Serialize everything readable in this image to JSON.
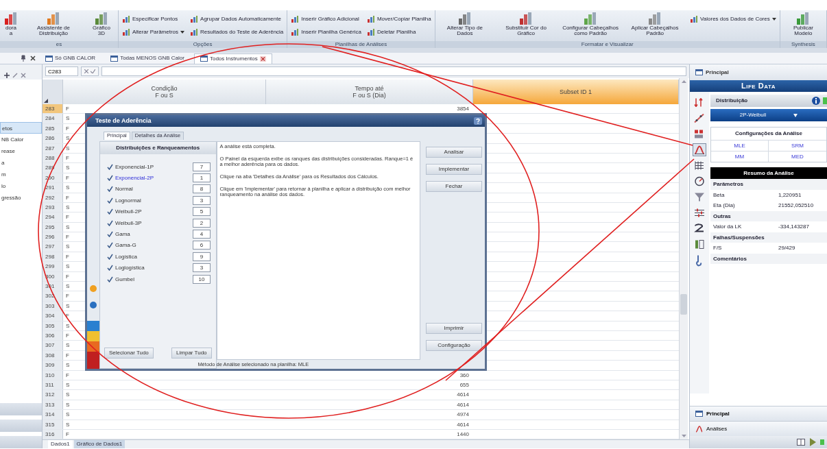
{
  "ribbon": {
    "groups": [
      {
        "label": "es",
        "items": [
          {
            "kind": "large",
            "label": "dora\na"
          },
          {
            "kind": "large",
            "label": "Assistente de Distribuição"
          },
          {
            "kind": "large",
            "label": "Gráfico 3D"
          }
        ]
      },
      {
        "label": "Opções",
        "items": [
          {
            "kind": "small",
            "label": "Especificar Pontos",
            "dropdown": false
          },
          {
            "kind": "small",
            "label": "Alterar Parâmetros",
            "dropdown": true
          },
          {
            "kind": "small",
            "label": "Agrupar Dados Automaticamente",
            "dropdown": false
          },
          {
            "kind": "small",
            "label": "Resultados do Teste de Aderência",
            "dropdown": false
          }
        ]
      },
      {
        "label": "Planilhas de Análises",
        "items": [
          {
            "kind": "small",
            "label": "Inserir Gráfico Adicional",
            "dropdown": false
          },
          {
            "kind": "small",
            "label": "Inserir Planilha Genérica",
            "dropdown": false
          },
          {
            "kind": "small",
            "label": "Mover/Copiar Planilha",
            "dropdown": false
          },
          {
            "kind": "small",
            "label": "Deletar Planilha",
            "dropdown": false
          }
        ]
      },
      {
        "label": "Formatar e Visualizar",
        "items": [
          {
            "kind": "large",
            "label": "Alterar Tipo de Dados"
          },
          {
            "kind": "large",
            "label": "Substituir Cor do Gráfico"
          },
          {
            "kind": "large",
            "label": "Configurar Cabeçalhos como Padrão"
          },
          {
            "kind": "large",
            "label": "Aplicar Cabeçalhos Padrão"
          },
          {
            "kind": "small",
            "label": "Valores dos Dados de Cores",
            "dropdown": true
          }
        ]
      },
      {
        "label": "Synthesis",
        "items": [
          {
            "kind": "large",
            "label": "Publicar Modelo"
          }
        ]
      }
    ]
  },
  "doc_tabs": [
    {
      "label": "Só GNB CALOR",
      "selected": false
    },
    {
      "label": "Todas MENOS GNB Calor",
      "selected": false
    },
    {
      "label": "Todos Instrumentos",
      "selected": true
    }
  ],
  "left_panel": {
    "items": [
      {
        "label": "etos",
        "selected": true
      },
      {
        "label": "NB Calor",
        "selected": false
      },
      {
        "label": "rease",
        "selected": false
      },
      {
        "label": "a",
        "selected": false
      },
      {
        "label": "m",
        "selected": false
      },
      {
        "label": "lo",
        "selected": false
      },
      {
        "label": "gressão",
        "selected": false
      }
    ]
  },
  "formula_bar": {
    "cell": "C283"
  },
  "grid": {
    "columns": [
      {
        "lines": [
          "Condição",
          "F ou S"
        ],
        "selected": false
      },
      {
        "lines": [
          "Tempo até",
          "F ou S (Dia)"
        ],
        "selected": false
      },
      {
        "lines": [
          "Subset ID 1"
        ],
        "selected": true
      }
    ],
    "rows": [
      {
        "n": "283",
        "cond": "F",
        "time": "3854",
        "selected": true
      },
      {
        "n": "284",
        "cond": "S",
        "selected": false
      },
      {
        "n": "285",
        "cond": "F",
        "selected": false
      },
      {
        "n": "286",
        "cond": "S",
        "selected": false
      },
      {
        "n": "287",
        "cond": "S",
        "selected": false
      },
      {
        "n": "288",
        "cond": "F",
        "selected": false
      },
      {
        "n": "289",
        "cond": "S",
        "selected": false
      },
      {
        "n": "290",
        "cond": "F",
        "selected": false
      },
      {
        "n": "291",
        "cond": "S",
        "selected": false
      },
      {
        "n": "292",
        "cond": "F",
        "selected": false
      },
      {
        "n": "293",
        "cond": "S",
        "selected": false
      },
      {
        "n": "294",
        "cond": "F",
        "selected": false
      },
      {
        "n": "295",
        "cond": "S",
        "selected": false
      },
      {
        "n": "296",
        "cond": "F",
        "selected": false
      },
      {
        "n": "297",
        "cond": "S",
        "selected": false
      },
      {
        "n": "298",
        "cond": "F",
        "selected": false
      },
      {
        "n": "299",
        "cond": "S",
        "selected": false
      },
      {
        "n": "300",
        "cond": "F",
        "selected": false
      },
      {
        "n": "301",
        "cond": "S",
        "selected": false
      },
      {
        "n": "302",
        "cond": "F",
        "selected": false
      },
      {
        "n": "303",
        "cond": "S",
        "selected": false
      },
      {
        "n": "304",
        "cond": "F",
        "selected": false
      },
      {
        "n": "305",
        "cond": "S",
        "selected": false
      },
      {
        "n": "306",
        "cond": "F",
        "selected": false
      },
      {
        "n": "307",
        "cond": "S",
        "selected": false
      },
      {
        "n": "308",
        "cond": "F",
        "selected": false
      },
      {
        "n": "309",
        "cond": "S",
        "selected": false
      },
      {
        "n": "310",
        "cond": "F",
        "time": "360",
        "selected": false
      },
      {
        "n": "311",
        "cond": "S",
        "time": "655",
        "selected": false
      },
      {
        "n": "312",
        "cond": "S",
        "time": "4614",
        "selected": false
      },
      {
        "n": "313",
        "cond": "S",
        "time": "4614",
        "selected": false
      },
      {
        "n": "314",
        "cond": "S",
        "time": "4974",
        "selected": false
      },
      {
        "n": "315",
        "cond": "S",
        "time": "4614",
        "selected": false
      },
      {
        "n": "316",
        "cond": "F",
        "time": "1440",
        "selected": false
      }
    ]
  },
  "sheet_tabs": [
    {
      "label": "Dados1",
      "selected": true
    },
    {
      "label": "Gráfico de Dados1",
      "selected": false
    }
  ],
  "dialog": {
    "title": "Teste de Aderência",
    "tabs": [
      {
        "label": "Principal",
        "selected": true
      },
      {
        "label": "Detalhes da Análise",
        "selected": false
      }
    ],
    "list_heading": "Distribuições e Ranqueamentos",
    "distributions": [
      {
        "name": "Exponencial-1P",
        "checked": true,
        "rank": "7",
        "best": false
      },
      {
        "name": "Exponencial-2P",
        "checked": true,
        "rank": "1",
        "best": true
      },
      {
        "name": "Normal",
        "checked": true,
        "rank": "8",
        "best": false
      },
      {
        "name": "Lognormal",
        "checked": true,
        "rank": "3",
        "best": false
      },
      {
        "name": "Weibull-2P",
        "checked": true,
        "rank": "5",
        "best": false
      },
      {
        "name": "Weibull-3P",
        "checked": true,
        "rank": "2",
        "best": false
      },
      {
        "name": "Gama",
        "checked": true,
        "rank": "4",
        "best": false
      },
      {
        "name": "Gama-G",
        "checked": true,
        "rank": "6",
        "best": false
      },
      {
        "name": "Logística",
        "checked": true,
        "rank": "9",
        "best": false
      },
      {
        "name": "Loglogística",
        "checked": true,
        "rank": "3",
        "best": false
      },
      {
        "name": "Gumbel",
        "checked": true,
        "rank": "10",
        "best": false
      }
    ],
    "list_buttons": [
      "Selecionar Tudo",
      "Limpar Tudo"
    ],
    "messages": [
      "A análise está completa.",
      "O Painel da esquerda exibe os ranques das distribuições consideradas. Ranque=1 é a melhor aderência para os dados.",
      "Clique na aba 'Detalhes da Análise' para os Resultados dos Cálculos.",
      "Clique em 'Implementar' para retornar à planilha e aplicar a distribuição com melhor ranqueamento na análise dos dados."
    ],
    "actions_top": [
      "Analisar",
      "Implementar",
      "Fechar"
    ],
    "actions_bottom": [
      "Imprimir",
      "Configuração"
    ],
    "footer": "Método de Análise selecionado na planilha: MLE"
  },
  "panel": {
    "title": "Principal",
    "app_title": "Life Data",
    "distribution_label": "Distribuição",
    "distribution": "2P-Weibull",
    "tools": [
      {
        "selected": false
      },
      {
        "selected": false
      },
      {
        "selected": false
      },
      {
        "selected": true
      },
      {
        "selected": false
      },
      {
        "selected": false
      },
      {
        "selected": false
      },
      {
        "selected": false
      },
      {
        "selected": false
      },
      {
        "selected": false
      },
      {
        "selected": false
      }
    ],
    "config_title": "Configurações da Análise",
    "methods": [
      "MLE",
      "SRM",
      "MM",
      "MED"
    ],
    "summary_title": "Resumo da Análise",
    "summary": [
      {
        "kind": "heading",
        "label": "Parâmetros"
      },
      {
        "kind": "value",
        "label": "Beta",
        "value": "1,220951"
      },
      {
        "kind": "value",
        "label": "Eta (Dia)",
        "value": "21552,052510"
      },
      {
        "kind": "heading",
        "label": "Outras"
      },
      {
        "kind": "value",
        "label": "Valor da LK",
        "value": "-334,143287"
      },
      {
        "kind": "heading",
        "label": "Falhas/Suspensões"
      },
      {
        "kind": "value",
        "label": "F/S",
        "value": "29/429"
      },
      {
        "kind": "heading",
        "label": "Comentários"
      }
    ],
    "nav": [
      "Principal",
      "Análises"
    ]
  },
  "annotation": {
    "ellipse": true,
    "pointers": true
  }
}
